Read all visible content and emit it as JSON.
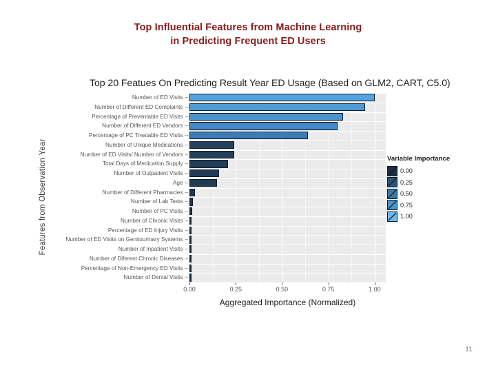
{
  "slide": {
    "title_line1": "Top Influential Features from Machine Learning",
    "title_line2": "in Predicting Frequent ED Users",
    "title_color": "#8B1A1A",
    "page_number": "11"
  },
  "chart_data": {
    "type": "bar",
    "orientation": "horizontal",
    "title": "Top 20 Featues On Predicting Result Year ED Usage (Based on GLM2, CART, C5.0)",
    "xlabel": "Aggregated Importance (Normalized)",
    "ylabel": "Features from Observation Year",
    "xlim": [
      0,
      1.06
    ],
    "xticks": [
      0.0,
      0.25,
      0.5,
      0.75,
      1.0
    ],
    "xticklabels": [
      "0.00",
      "0.25",
      "0.50",
      "0.75",
      "1.00"
    ],
    "grid": true,
    "grid_color": "#ffffff",
    "panel_background": "#ebebeb",
    "categories": [
      "Number of ED Visits",
      "Number of Different ED Complaints",
      "Percentage of Preventable ED Visits",
      "Number of Different ED Vendors",
      "Percentage of PC Treatable ED Visits",
      "Number of Unique Medications",
      "Number of ED Visits/ Number of Vendors",
      "Total Days of Medication Supply",
      "Number of Outpatient Visits",
      "Age",
      "Number of Different Pharmacies",
      "Number of Lab Tests",
      "Number of PC Visits",
      "Number of Chronic Visits",
      "Percentage of ED Injury Visits",
      "Number of ED Visits on Genitourinary Systems",
      "Number of Inpatient Visits",
      "Number of Diferent Chronic Diseases",
      "Percentage of Non-Emergency ED Visits",
      "Number of Dental Visits"
    ],
    "values": [
      1.0,
      0.95,
      0.83,
      0.8,
      0.64,
      0.24,
      0.24,
      0.21,
      0.16,
      0.15,
      0.03,
      0.02,
      0.015,
      0.012,
      0.008,
      0.006,
      0.004,
      0.003,
      0.002,
      0.001
    ],
    "bar_colors": [
      "#54a3dd",
      "#4f9bd6",
      "#4a93cf",
      "#4489c7",
      "#3c7cb8",
      "#24425f",
      "#23405c",
      "#223e59",
      "#213c56",
      "#203a53",
      "#1f3850",
      "#1e364d",
      "#1d344a",
      "#1c3247",
      "#1b3044",
      "#1a2e41",
      "#192c3e",
      "#182a3b",
      "#172838",
      "#162635"
    ],
    "bar_border_color": "#0f1b28",
    "legend": {
      "title": "Variable Importance",
      "position": "right",
      "entries": [
        {
          "label": "0.00",
          "color": "#1c2e42"
        },
        {
          "label": "0.25",
          "color": "#2e5578"
        },
        {
          "label": "0.50",
          "color": "#3d7aa8"
        },
        {
          "label": "0.75",
          "color": "#4a95cc"
        },
        {
          "label": "1.00",
          "color": "#6bb8ef"
        }
      ]
    }
  }
}
